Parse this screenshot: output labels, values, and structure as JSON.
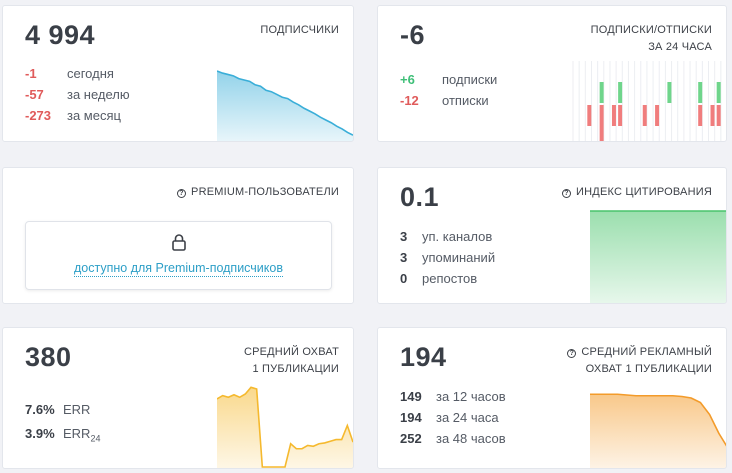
{
  "subscribers": {
    "value": "4 994",
    "title": "ПОДПИСЧИКИ",
    "rows": [
      {
        "value": "-1",
        "label": "сегодня"
      },
      {
        "value": "-57",
        "label": "за неделю"
      },
      {
        "value": "-273",
        "label": "за месяц"
      }
    ],
    "chart_data": {
      "type": "area",
      "values": [
        1.0,
        0.97,
        0.95,
        0.93,
        0.89,
        0.87,
        0.85,
        0.8,
        0.78,
        0.72,
        0.7,
        0.66,
        0.62,
        0.6,
        0.55,
        0.51,
        0.46,
        0.42,
        0.38,
        0.33,
        0.29,
        0.25,
        0.2,
        0.16,
        0.11,
        0.07
      ],
      "color": "#3aaed8"
    }
  },
  "subs_unsubs": {
    "value": "-6",
    "title_line1": "ПОДПИСКИ/ОТПИСКИ",
    "title_line2": "ЗА 24 ЧАСА",
    "rows": [
      {
        "value": "+6",
        "label": "подписки"
      },
      {
        "value": "-12",
        "label": "отписки"
      }
    ],
    "chart_data": {
      "type": "bar",
      "pos": [
        0,
        0,
        0,
        0,
        1,
        0,
        0,
        1,
        0,
        0,
        0,
        0,
        0,
        0,
        0,
        1,
        0,
        0,
        0,
        0,
        1,
        0,
        0,
        1,
        0
      ],
      "neg": [
        0,
        0,
        1,
        0,
        2,
        0,
        1,
        1,
        0,
        0,
        0,
        1,
        0,
        1,
        0,
        0,
        0,
        0,
        0,
        0,
        1,
        0,
        1,
        1,
        0
      ],
      "pos_color": "#6fd58b",
      "neg_color": "#f07d7d"
    }
  },
  "premium": {
    "title": "PREMIUM-ПОЛЬЗОВАТЕЛИ",
    "lock_text": "доступно для Premium-подписчиков"
  },
  "citation": {
    "value": "0.1",
    "title": "ИНДЕКС ЦИТИРОВАНИЯ",
    "rows": [
      {
        "value": "3",
        "label": "уп. каналов"
      },
      {
        "value": "3",
        "label": "упоминаний"
      },
      {
        "value": "0",
        "label": "репостов"
      }
    ],
    "chart_data": {
      "type": "area",
      "values": [
        1,
        1
      ],
      "color": "#49c46b"
    }
  },
  "avg_reach": {
    "value": "380",
    "title_line1": "СРЕДНИЙ ОХВАТ",
    "title_line2": "1 ПУБЛИКАЦИИ",
    "rows": [
      {
        "value": "7.6%",
        "label": "ERR",
        "sub": ""
      },
      {
        "value": "3.9%",
        "label": "ERR",
        "sub": "24"
      }
    ],
    "chart_data": {
      "type": "area",
      "values": [
        0.82,
        0.86,
        0.84,
        0.87,
        0.84,
        0.88,
        0.96,
        0.94,
        0.0,
        0.0,
        0.0,
        0.0,
        0.0,
        0.28,
        0.22,
        0.22,
        0.26,
        0.25,
        0.28,
        0.29,
        0.31,
        0.33,
        0.33,
        0.5,
        0.3
      ],
      "color": "#f5b92e"
    }
  },
  "avg_ad_reach": {
    "value": "194",
    "title_line1": "СРЕДНИЙ РЕКЛАМНЫЙ",
    "title_line2": "ОХВАТ 1 ПУБЛИКАЦИИ",
    "rows": [
      {
        "value": "149",
        "label": "за 12 часов"
      },
      {
        "value": "194",
        "label": "за 24 часа"
      },
      {
        "value": "252",
        "label": "за 48 часов"
      }
    ],
    "chart_data": {
      "type": "area",
      "values": [
        0.97,
        0.97,
        0.97,
        0.97,
        0.96,
        0.95,
        0.95,
        0.95,
        0.95,
        0.95,
        0.94,
        0.92,
        0.86,
        0.7,
        0.45,
        0.25
      ],
      "color": "#f39b2a"
    }
  }
}
